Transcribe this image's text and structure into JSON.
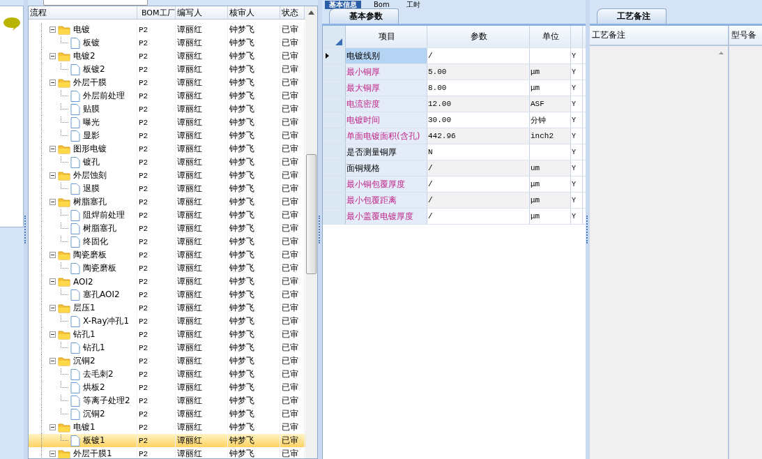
{
  "top_tabs": [
    {
      "label": "基本信息",
      "selected": true
    },
    {
      "label": "Bom",
      "selected": false
    },
    {
      "label": "工时",
      "selected": false
    }
  ],
  "tree": {
    "columns": [
      "流程",
      "BOM工厂",
      "编写人",
      "核审人",
      "状态"
    ],
    "nodes": [
      {
        "name": "电镀",
        "factory": "P2",
        "author": "谭丽红",
        "reviewer": "钟梦飞",
        "status": "已审",
        "expanded": true,
        "selected": false,
        "children": [
          {
            "name": "板镀",
            "factory": "P2",
            "author": "谭丽红",
            "reviewer": "钟梦飞",
            "status": "已审",
            "selected": false
          }
        ]
      },
      {
        "name": "电镀2",
        "factory": "P2",
        "author": "谭丽红",
        "reviewer": "钟梦飞",
        "status": "已审",
        "expanded": true,
        "selected": false,
        "children": [
          {
            "name": "板镀2",
            "factory": "P2",
            "author": "谭丽红",
            "reviewer": "钟梦飞",
            "status": "已审",
            "selected": false
          }
        ]
      },
      {
        "name": "外层干膜",
        "factory": "P2",
        "author": "谭丽红",
        "reviewer": "钟梦飞",
        "status": "已审",
        "expanded": true,
        "selected": false,
        "children": [
          {
            "name": "外层前处理",
            "factory": "P2",
            "author": "谭丽红",
            "reviewer": "钟梦飞",
            "status": "已审",
            "selected": false
          },
          {
            "name": "贴膜",
            "factory": "P2",
            "author": "谭丽红",
            "reviewer": "钟梦飞",
            "status": "已审",
            "selected": false
          },
          {
            "name": "曝光",
            "factory": "P2",
            "author": "谭丽红",
            "reviewer": "钟梦飞",
            "status": "已审",
            "selected": false
          },
          {
            "name": "显影",
            "factory": "P2",
            "author": "谭丽红",
            "reviewer": "钟梦飞",
            "status": "已审",
            "selected": false
          }
        ]
      },
      {
        "name": "图形电镀",
        "factory": "P2",
        "author": "谭丽红",
        "reviewer": "钟梦飞",
        "status": "已审",
        "expanded": true,
        "selected": false,
        "children": [
          {
            "name": "镀孔",
            "factory": "P2",
            "author": "谭丽红",
            "reviewer": "钟梦飞",
            "status": "已审",
            "selected": false
          }
        ]
      },
      {
        "name": "外层蚀刻",
        "factory": "P2",
        "author": "谭丽红",
        "reviewer": "钟梦飞",
        "status": "已审",
        "expanded": true,
        "selected": false,
        "children": [
          {
            "name": "退膜",
            "factory": "P2",
            "author": "谭丽红",
            "reviewer": "钟梦飞",
            "status": "已审",
            "selected": false
          }
        ]
      },
      {
        "name": "树脂塞孔",
        "factory": "P2",
        "author": "谭丽红",
        "reviewer": "钟梦飞",
        "status": "已审",
        "expanded": true,
        "selected": false,
        "children": [
          {
            "name": "阻焊前处理",
            "factory": "P2",
            "author": "谭丽红",
            "reviewer": "钟梦飞",
            "status": "已审",
            "selected": false
          },
          {
            "name": "树脂塞孔",
            "factory": "P2",
            "author": "谭丽红",
            "reviewer": "钟梦飞",
            "status": "已审",
            "selected": false
          },
          {
            "name": "终固化",
            "factory": "P2",
            "author": "谭丽红",
            "reviewer": "钟梦飞",
            "status": "已审",
            "selected": false
          }
        ]
      },
      {
        "name": "陶瓷磨板",
        "factory": "P2",
        "author": "谭丽红",
        "reviewer": "钟梦飞",
        "status": "已审",
        "expanded": true,
        "selected": false,
        "children": [
          {
            "name": "陶瓷磨板",
            "factory": "P2",
            "author": "谭丽红",
            "reviewer": "钟梦飞",
            "status": "已审",
            "selected": false
          }
        ]
      },
      {
        "name": "AOI2",
        "factory": "P2",
        "author": "谭丽红",
        "reviewer": "钟梦飞",
        "status": "已审",
        "expanded": true,
        "selected": false,
        "children": [
          {
            "name": "塞孔AOI2",
            "factory": "P2",
            "author": "谭丽红",
            "reviewer": "钟梦飞",
            "status": "已审",
            "selected": false
          }
        ]
      },
      {
        "name": "层压1",
        "factory": "P2",
        "author": "谭丽红",
        "reviewer": "钟梦飞",
        "status": "已审",
        "expanded": true,
        "selected": false,
        "children": [
          {
            "name": "X-Ray冲孔1",
            "factory": "P2",
            "author": "谭丽红",
            "reviewer": "钟梦飞",
            "status": "已审",
            "selected": false
          }
        ]
      },
      {
        "name": "钻孔1",
        "factory": "P2",
        "author": "谭丽红",
        "reviewer": "钟梦飞",
        "status": "已审",
        "expanded": true,
        "selected": false,
        "children": [
          {
            "name": "钻孔1",
            "factory": "P2",
            "author": "谭丽红",
            "reviewer": "钟梦飞",
            "status": "已审",
            "selected": false
          }
        ]
      },
      {
        "name": "沉铜2",
        "factory": "P2",
        "author": "谭丽红",
        "reviewer": "钟梦飞",
        "status": "已审",
        "expanded": true,
        "selected": false,
        "children": [
          {
            "name": "去毛刺2",
            "factory": "P2",
            "author": "谭丽红",
            "reviewer": "钟梦飞",
            "status": "已审",
            "selected": false
          },
          {
            "name": "烘板2",
            "factory": "P2",
            "author": "谭丽红",
            "reviewer": "钟梦飞",
            "status": "已审",
            "selected": false
          },
          {
            "name": "等离子处理2",
            "factory": "P2",
            "author": "谭丽红",
            "reviewer": "钟梦飞",
            "status": "已审",
            "selected": false
          },
          {
            "name": "沉铜2",
            "factory": "P2",
            "author": "谭丽红",
            "reviewer": "钟梦飞",
            "status": "已审",
            "selected": false
          }
        ]
      },
      {
        "name": "电镀1",
        "factory": "P2",
        "author": "谭丽红",
        "reviewer": "钟梦飞",
        "status": "已审",
        "expanded": true,
        "selected": false,
        "children": [
          {
            "name": "板镀1",
            "factory": "P2",
            "author": "谭丽红",
            "reviewer": "钟梦飞",
            "status": "已审",
            "selected": true
          }
        ]
      },
      {
        "name": "外层干膜1",
        "factory": "P2",
        "author": "谭丽红",
        "reviewer": "钟梦飞",
        "status": "已审",
        "expanded": true,
        "selected": false
      }
    ]
  },
  "params": {
    "tab": "基本参数",
    "columns": [
      "项目",
      "参数",
      "单位"
    ],
    "rows": [
      {
        "item": "电镀线别",
        "value": "/",
        "flag": "Y",
        "highlighted": false,
        "selected": true
      },
      {
        "item": "最小铜厚",
        "value": "5.00",
        "unit": "μm",
        "flag": "Y",
        "highlighted": true,
        "selected": false
      },
      {
        "item": "最大铜厚",
        "value": "8.00",
        "unit": "μm",
        "flag": "Y",
        "highlighted": true,
        "selected": false
      },
      {
        "item": "电流密度",
        "value": "12.00",
        "unit": "ASF",
        "flag": "Y",
        "highlighted": true,
        "selected": false
      },
      {
        "item": "电镀时间",
        "value": "30.00",
        "unit": "分钟",
        "flag": "Y",
        "highlighted": true,
        "selected": false
      },
      {
        "item": "单面电镀面积(含孔)",
        "value": "442.96",
        "unit": "inch2",
        "flag": "Y",
        "highlighted": true,
        "selected": false
      },
      {
        "item": "是否测量铜厚",
        "value": "N",
        "flag": "Y",
        "highlighted": false,
        "selected": false
      },
      {
        "item": "面铜规格",
        "value": "/",
        "unit": "um",
        "flag": "Y",
        "highlighted": false,
        "selected": false
      },
      {
        "item": "最小铜包覆厚度",
        "value": "/",
        "unit": "μm",
        "flag": "Y",
        "highlighted": true,
        "selected": false
      },
      {
        "item": "最小包覆距离",
        "value": "/",
        "unit": "μm",
        "flag": "Y",
        "highlighted": true,
        "selected": false
      },
      {
        "item": "最小盖覆电镀厚度",
        "value": "/",
        "unit": "μm",
        "flag": "Y",
        "highlighted": true,
        "selected": false
      }
    ]
  },
  "notes": {
    "tab": "工艺备注",
    "columns": [
      "工艺备注",
      "型号备"
    ]
  }
}
